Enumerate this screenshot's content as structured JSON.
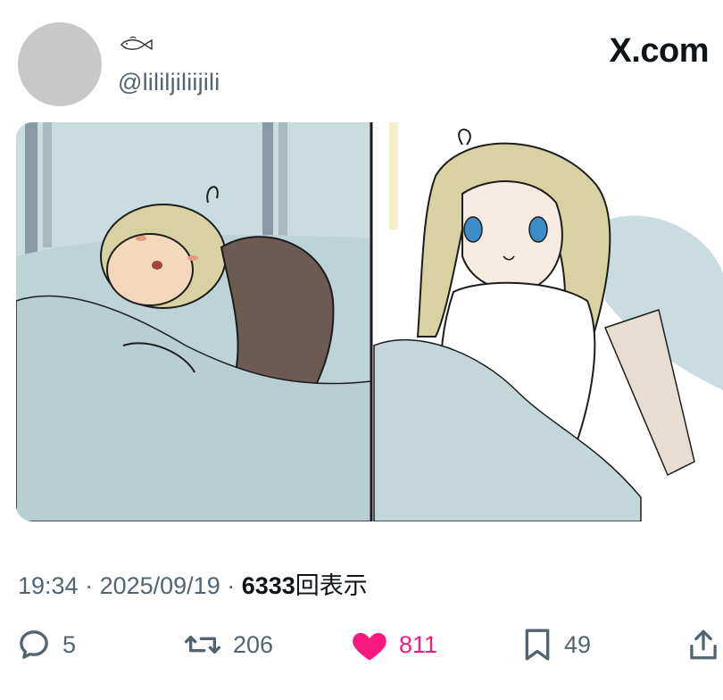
{
  "brand": "X.com",
  "author": {
    "handle": "@lililjiliijili",
    "display_name_icon": "fish-icon"
  },
  "post": {
    "media_description": "two-panel illustration",
    "meta": {
      "time": "19:34",
      "separator": " · ",
      "date": "2025/09/19",
      "views": "6333",
      "views_label": "回表示"
    },
    "actions": {
      "replies": "5",
      "reposts": "206",
      "likes": "811",
      "bookmarks": "49"
    }
  },
  "colors": {
    "text_primary": "#0f1419",
    "text_secondary": "#536471",
    "like": "#f91880",
    "avatar": "#c8c8c8"
  }
}
